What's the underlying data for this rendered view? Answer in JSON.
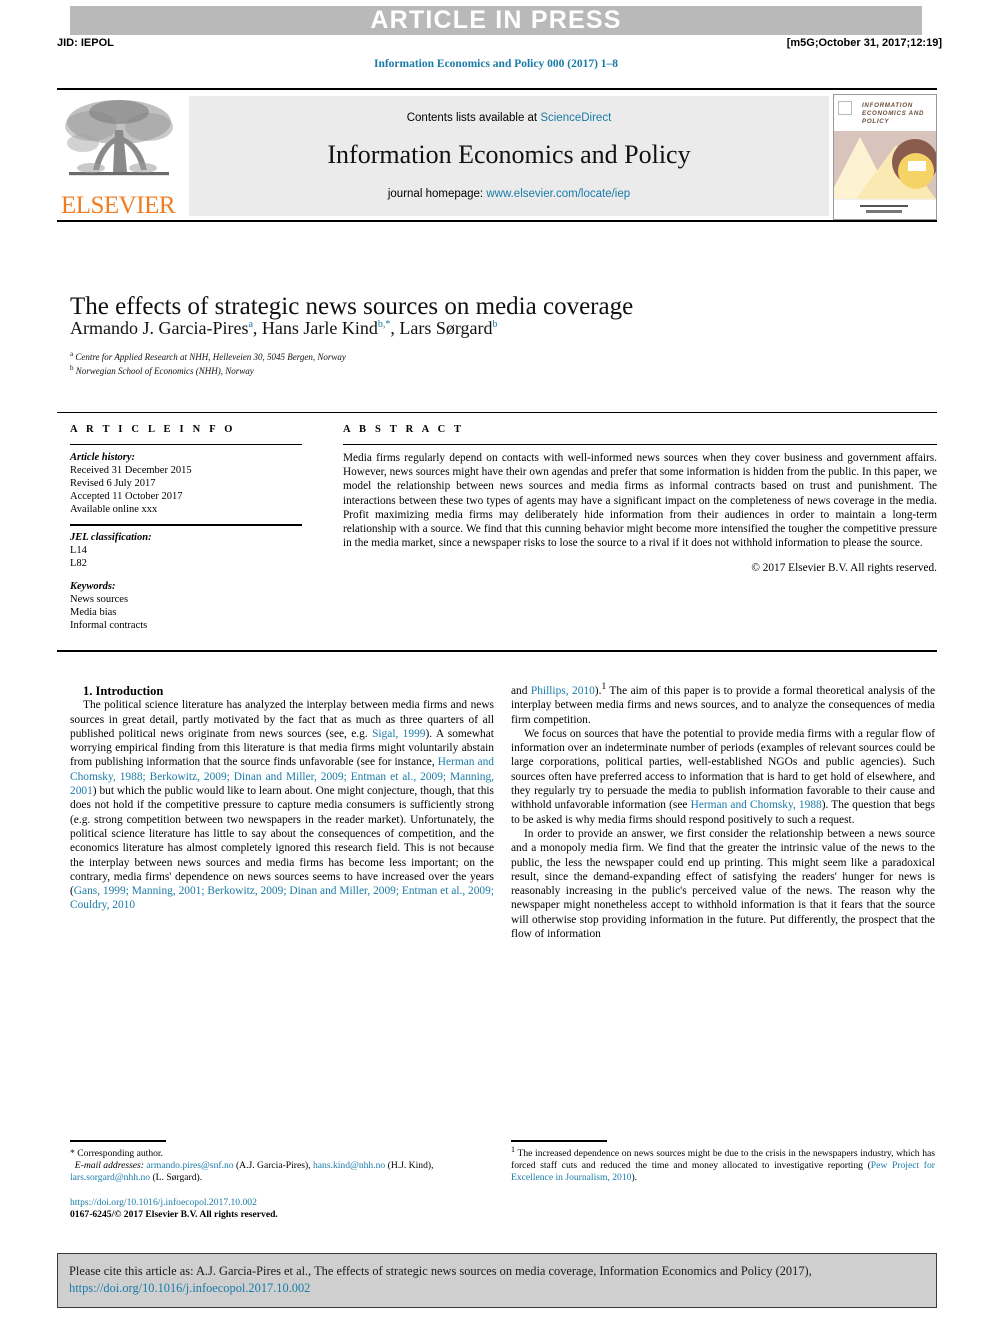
{
  "banner": {
    "article_in_press": "ARTICLE IN PRESS",
    "jid": "JID: IEPOL",
    "stamp": "[m5G;October 31, 2017;12:19]"
  },
  "running_head": "Information Economics and Policy 000 (2017) 1–8",
  "masthead": {
    "contents_prefix": "Contents lists available at ",
    "contents_link": "ScienceDirect",
    "journal_title": "Information Economics and Policy",
    "homepage_prefix": "journal homepage: ",
    "homepage_link": "www.elsevier.com/locate/iep",
    "publisher_wordmark": "ELSEVIER",
    "cover_title": "INFORMATION ECONOMICS AND POLICY"
  },
  "article": {
    "title": "The effects of strategic news sources on media coverage",
    "authors_html": "Armando J. Garcia-Pires<sup>a</sup>, Hans Jarle Kind<sup>b,*</sup>, Lars Sørgard<sup>b</sup>",
    "affiliation_a": "Centre for Applied Research at NHH, Helleveien 30, 5045 Bergen, Norway",
    "affiliation_b": "Norwegian School of Economics (NHH), Norway"
  },
  "info": {
    "heading": "A R T I C L E    I N F O",
    "history_label": "Article history:",
    "received": "Received 31 December 2015",
    "revised": "Revised 6 July 2017",
    "accepted": "Accepted 11 October 2017",
    "available": "Available online xxx",
    "jel_label": "JEL classification:",
    "jel_codes": [
      "L14",
      "L82"
    ],
    "keywords_label": "Keywords:",
    "keywords": [
      "News sources",
      "Media bias",
      "Informal contracts"
    ]
  },
  "abstract": {
    "heading": "A B S T R A C T",
    "text": "Media firms regularly depend on contacts with well-informed news sources when they cover business and government affairs. However, news sources might have their own agendas and prefer that some information is hidden from the public. In this paper, we model the relationship between news sources and media firms as informal contracts based on trust and punishment. The interactions between these two types of agents may have a significant impact on the completeness of news coverage in the media. Profit maximizing media firms may deliberately hide information from their audiences in order to maintain a long-term relationship with a source. We find that this cunning behavior might become more intensified the tougher the competitive pressure in the media market, since a newspaper risks to lose the source to a rival if it does not withhold information to please the source.",
    "rights": "© 2017 Elsevier B.V. All rights reserved."
  },
  "body": {
    "section_1_title": "1. Introduction",
    "left_p1_html": "The political science literature has analyzed the interplay between media firms and news sources in great detail, partly motivated by the fact that as much as three quarters of all published political news originate from news sources (see, e.g. <span class=\"link\">Sigal, 1999</span>). A somewhat worrying empirical finding from this literature is that media firms might voluntarily abstain from publishing information that the source finds unfavorable (see for instance, <span class=\"link\">Herman and Chomsky, 1988; Berkowitz, 2009; Dinan and Miller, 2009; Entman et al., 2009; Manning, 2001</span>) but which the public would like to learn about. One might conjecture, though, that this does not hold if the competitive pressure to capture media consumers is sufficiently strong (e.g. strong competition between two newspapers in the reader market). Unfortunately, the political science literature has little to say about the consequences of competition, and the economics literature has almost completely ignored this research field. This is not because the interplay between news sources and media firms has become less important; on the contrary, media firms' dependence on news sources seems to have increased over the years (<span class=\"link\">Gans, 1999; Manning, 2001; Berkowitz, 2009; Dinan and Miller, 2009; Entman et al., 2009; Couldry, 2010</span>",
    "right_p1_html": "and <span class=\"link\">Phillips, 2010</span>).<sup>1</sup> The aim of this paper is to provide a formal theoretical analysis of the interplay between media firms and news sources, and to analyze the consequences of media firm competition.",
    "right_p2_html": "We focus on sources that have the potential to provide media firms with a regular flow of information over an indeterminate number of periods (examples of relevant sources could be large corporations, political parties, well-established NGOs and public agencies). Such sources often have preferred access to information that is hard to get hold of elsewhere, and they regularly try to persuade the media to publish information favorable to their cause and withhold unfavorable information (see <span class=\"link\">Herman and Chomsky, 1988</span>). The question that begs to be asked is why media firms should respond positively to such a request.",
    "right_p3_html": "In order to provide an answer, we first consider the relationship between a news source and a monopoly media firm. We find that the greater the intrinsic value of the news to the public, the less the newspaper could end up printing. This might seem like a paradoxical result, since the demand-expanding effect of satisfying the readers' hunger for news is reasonably increasing in the public's perceived value of the news. The reason why the newspaper might nonetheless accept to withhold information is that it fears that the source will otherwise stop providing information in the future. Put differently, the prospect that the flow of information"
  },
  "footnotes": {
    "corresponding": "* Corresponding author.",
    "email_label": "E-mail addresses:",
    "emails_html": "<span class=\"link\">armando.pires@snf.no</span> (A.J. Garcia-Pires), <span class=\"link\">hans.kind@nhh.no</span> (H.J. Kind), <span class=\"link\">lars.sorgard@nhh.no</span> (L. Sørgard).",
    "doi": "https://doi.org/10.1016/j.infoecopol.2017.10.002",
    "issn": "0167-6245/© 2017 Elsevier B.V. All rights reserved.",
    "note_1_html": "<sup>1</sup> The increased dependence on news sources might be due to the crisis in the newspapers industry, which has forced staff cuts and reduced the time and money allocated to investigative reporting (<span class=\"link\">Pew Project for Excellence in Journalism, 2010</span>)."
  },
  "citation": {
    "text_html": "Please cite this article as: A.J. Garcia-Pires et al., The effects of strategic news sources on media coverage, Information Economics and Policy (2017), <span class=\"link\">https://doi.org/10.1016/j.infoecopol.2017.10.002</span>"
  },
  "colors": {
    "link": "#1a7ba8",
    "elsevier_orange": "#f07c22",
    "banner_gray": "#b9b9b9",
    "masthead_gray": "#ebebeb",
    "citation_gray": "#cfcfcf"
  }
}
